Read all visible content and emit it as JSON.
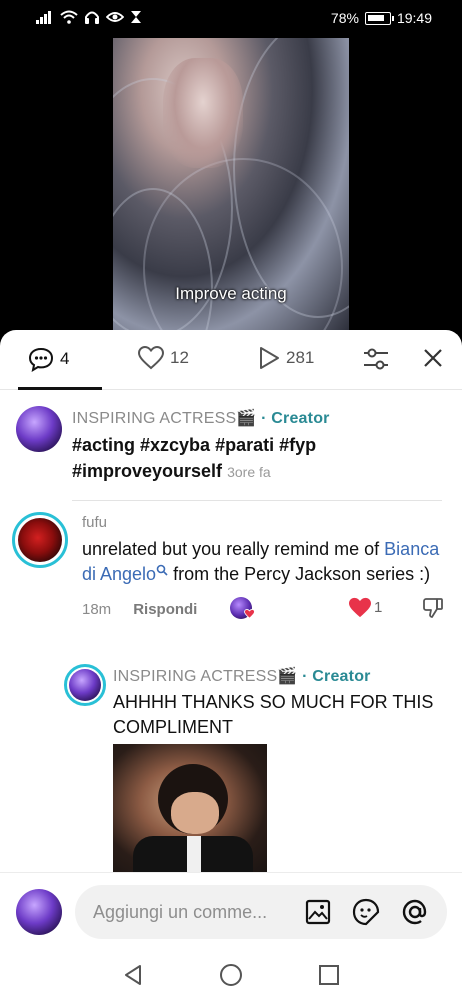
{
  "status_bar": {
    "battery": "78%",
    "time": "19:49"
  },
  "video": {
    "caption": "Improve acting"
  },
  "tabs": {
    "comments_count": "4",
    "likes_count": "12",
    "views_count": "281"
  },
  "post": {
    "author": "INSPIRING ACTRESS🎬",
    "creator_label": "· Creator",
    "text": "#acting #xzcyba #parati #fyp #improveyourself",
    "time": "3ore fa"
  },
  "comment": {
    "author": "fufu",
    "text_before": "unrelated but you really remind me of ",
    "link_text": "Bianca di Angelo",
    "text_after": " from the Percy Jackson series :)",
    "time": "18m",
    "reply_label": "Rispondi",
    "like_count": "1"
  },
  "reply": {
    "author": "INSPIRING ACTRESS🎬",
    "creator_label": "· Creator",
    "text": "AHHHH THANKS SO MUCH FOR THIS COMPLIMENT"
  },
  "composer": {
    "placeholder": "Aggiungi un comme..."
  },
  "colors": {
    "accent_teal": "#2a8a94",
    "like_red": "#e8334a",
    "link_blue": "#3b6bb5"
  }
}
